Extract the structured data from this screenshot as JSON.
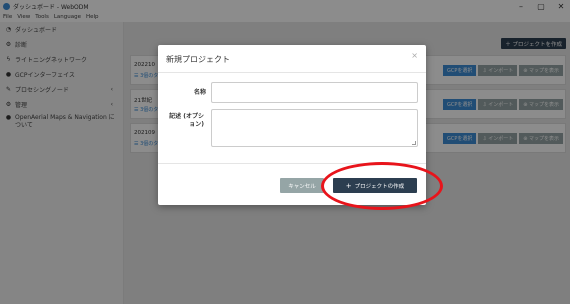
{
  "window": {
    "title": "ダッシュボード - WebODM",
    "minimize": "–",
    "maximize": "▢",
    "close": "✕"
  },
  "menubar": {
    "items": [
      "File",
      "View",
      "Tools",
      "Language",
      "Help"
    ]
  },
  "sidebar": {
    "items": [
      {
        "label": "ダッシュボード",
        "icon": "dashboard-icon",
        "glyph": "◔"
      },
      {
        "label": "診断",
        "icon": "gear-icon",
        "glyph": "⚙"
      },
      {
        "label": "ライトニングネットワーク",
        "icon": "bolt-icon",
        "glyph": "ϟ"
      },
      {
        "label": "GCPインターフェイス",
        "icon": "map-marker-icon",
        "glyph": "●"
      },
      {
        "label": "プロセシングノード",
        "icon": "wrench-icon",
        "glyph": "✎",
        "chevron": "‹"
      },
      {
        "label": "管理",
        "icon": "cogs-icon",
        "glyph": "⚙",
        "chevron": "‹"
      },
      {
        "label": "OpenAerial Maps & Navigation について",
        "icon": "info-icon",
        "glyph": "●"
      }
    ]
  },
  "main": {
    "new_project_label": "＋ プロジェクトを作成",
    "projects": [
      {
        "name": "202210",
        "sub": "☰ 3個のタ",
        "btn_gcp": "GCPを選択",
        "btn_import": "⇩ インポート",
        "btn_map": "⊕ マップを表示"
      },
      {
        "name": "21世紀",
        "sub": "☰ 3個のタ",
        "btn_gcp": "GCPを選択",
        "btn_import": "⇩ インポート",
        "btn_map": "⊕ マップを表示"
      },
      {
        "name": "202109",
        "sub": "☰ 3個のタ",
        "btn_gcp": "GCPを選択",
        "btn_import": "⇩ インポート",
        "btn_map": "⊕ マップを表示"
      }
    ]
  },
  "modal": {
    "title": "新規プロジェクト",
    "close": "×",
    "name_label": "名称",
    "name_value": "",
    "desc_label": "記述 (オプション)",
    "desc_value": "",
    "cancel_label": "キャンセル",
    "create_label": "プロジェクトの作成",
    "create_icon": "+"
  },
  "annotation": {
    "color": "#e8141b"
  },
  "colors": {
    "primary_dark": "#2c3e50",
    "secondary": "#95a5a6",
    "accent_blue": "#3c8dd6"
  }
}
